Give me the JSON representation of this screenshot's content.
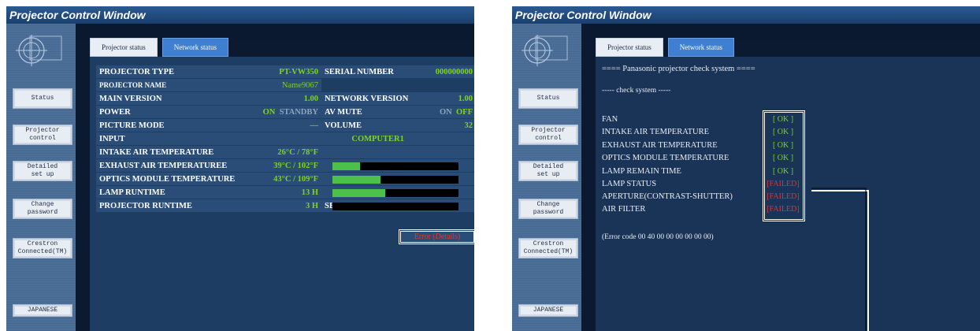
{
  "window_title": "Projector Control Window",
  "sidebar": {
    "items": [
      {
        "label": "Status"
      },
      {
        "label": "Projector\ncontrol"
      },
      {
        "label": "Detailed\nset up"
      },
      {
        "label": "Change\npassword"
      },
      {
        "label": "Crestron\nConnected(TM)"
      },
      {
        "label": "JAPANESE"
      }
    ]
  },
  "tabs": {
    "projector_status": "Projector status",
    "network_status": "Network status"
  },
  "status": {
    "projector_type_label": "PROJECTOR TYPE",
    "projector_type_value": "PT-VW350",
    "serial_number_label": "SERIAL NUMBER",
    "serial_number_value": "000000000",
    "projector_name_label": "PROJECTOR NAME",
    "projector_name_value": "Name9067",
    "main_version_label": "MAIN VERSION",
    "main_version_value": "1.00",
    "network_version_label": "NETWORK VERSION",
    "network_version_value": "1.00",
    "power_label": "POWER",
    "power_on": "ON",
    "power_standby": "STANDBY",
    "av_mute_label": "AV MUTE",
    "av_mute_on": "ON",
    "av_mute_off": "OFF",
    "picture_mode_label": "PICTURE MODE",
    "picture_mode_value": "—",
    "volume_label": "VOLUME",
    "volume_value": "32",
    "input_label": "INPUT",
    "input_value": "COMPUTER1",
    "intake_temp_label": "INTAKE AIR TEMPERATURE",
    "intake_temp_value": "26°C / 78°F",
    "intake_temp_level": 0.22,
    "exhaust_temp_label": "EXHAUST AIR TEMPERATUREE",
    "exhaust_temp_value": "39°C / 102°F",
    "exhaust_temp_level": 0.38,
    "optics_temp_label": "OPTICS MODULE TEMPERATURE",
    "optics_temp_value": "43°C / 109°F",
    "optics_temp_level": 0.42,
    "lamp_runtime_label": "LAMP RUNTIME",
    "lamp_runtime_value": "13 H",
    "lamp_runtime_level": 0.0,
    "projector_runtime_label": "PROJECTOR RUNTIME",
    "projector_runtime_value": "3 H",
    "self_test_label": "SELF TEST",
    "self_test_value": "Error (Details)"
  },
  "check": {
    "header": "==== Panasonic projector check system ====",
    "subheader": "----- check system -----",
    "items": [
      {
        "label": "FAN",
        "result": "[ OK ]",
        "status": "ok"
      },
      {
        "label": "INTAKE AIR TEMPERATURE",
        "result": "[ OK ]",
        "status": "ok"
      },
      {
        "label": "EXHAUST  AIR  TEMPERATURE",
        "result": "[ OK ]",
        "status": "ok"
      },
      {
        "label": "OPTICS MODULE TEMPERATURE",
        "result": "[ OK ]",
        "status": "ok"
      },
      {
        "label": "LAMP REMAIN TIME",
        "result": "[ OK ]",
        "status": "ok"
      },
      {
        "label": "LAMP STATUS",
        "result": "[FAILED]",
        "status": "failed"
      },
      {
        "label": "APERTURE(CONTRAST-SHUTTER)",
        "result": "[FAILED]",
        "status": "failed"
      },
      {
        "label": "AIR FILTER",
        "result": "[FAILED]",
        "status": "failed"
      }
    ],
    "error_code": "(Error code 00 40 00 00 00 00 00 00)"
  },
  "colors": {
    "ok": "#7ed321",
    "failed": "#e0342a",
    "title_bar": "#1b3f6d",
    "content_bg": "#1e3d63"
  }
}
